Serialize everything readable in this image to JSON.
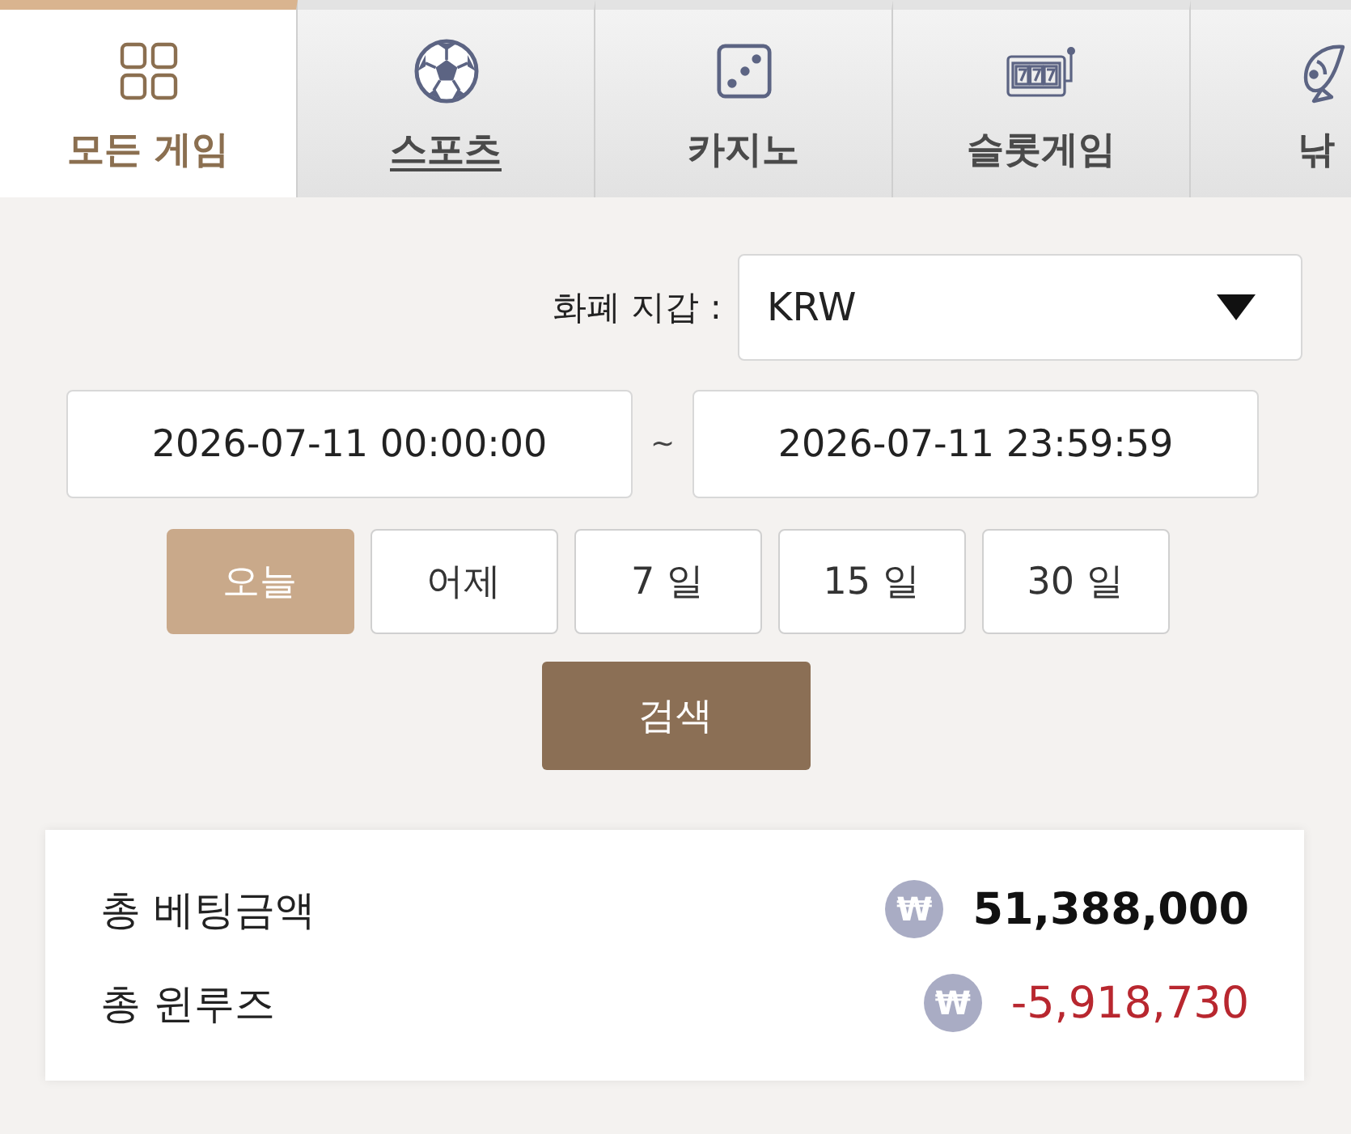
{
  "tabs": [
    {
      "label": "모든 게임",
      "kind": "grid",
      "selected": true,
      "underlined": false
    },
    {
      "label": "스포츠",
      "kind": "ball",
      "selected": false,
      "underlined": true
    },
    {
      "label": "카지노",
      "kind": "dice",
      "selected": false,
      "underlined": false
    },
    {
      "label": "슬롯게임",
      "kind": "slot",
      "selected": false,
      "underlined": false
    },
    {
      "label": "낚",
      "kind": "fish",
      "selected": false,
      "underlined": false
    }
  ],
  "filter": {
    "currency_label": "화폐 지갑 :",
    "currency_select": {
      "value": "KRW"
    },
    "date_from": {
      "value": "2026-07-11 00:00:00"
    },
    "date_separator": "~",
    "date_to": {
      "value": "2026-07-11 23:59:59"
    },
    "quick_ranges": [
      {
        "label": "오늘",
        "selected": true
      },
      {
        "label": "어제",
        "selected": false
      },
      {
        "label": "7 일",
        "selected": false
      },
      {
        "label": "15 일",
        "selected": false
      },
      {
        "label": "30 일",
        "selected": false
      }
    ],
    "search_button": "검색"
  },
  "summary": {
    "rows": [
      {
        "label": "총 베팅금액",
        "currency_icon": "₩",
        "value": "51,388,000",
        "negative": false
      },
      {
        "label": "총 윈루즈",
        "currency_icon": "₩",
        "value": "-5,918,730",
        "negative": true
      }
    ]
  }
}
